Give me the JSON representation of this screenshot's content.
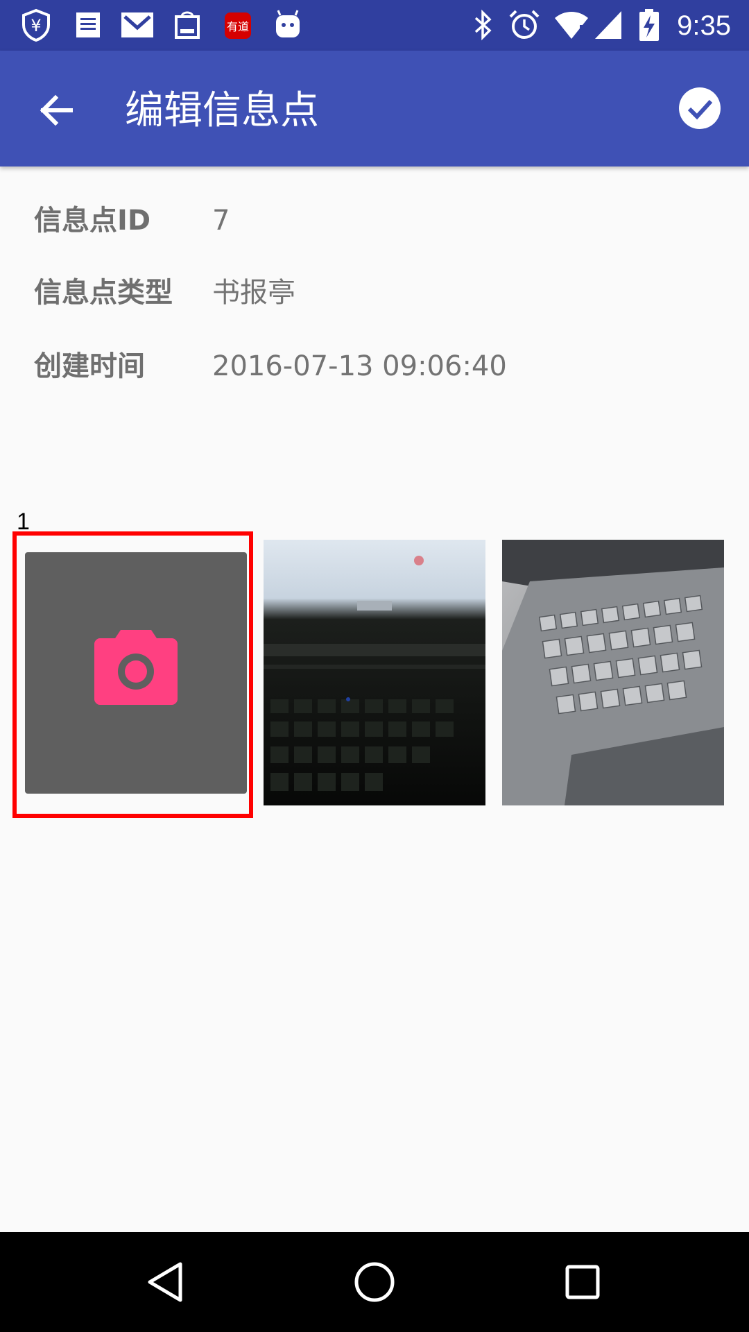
{
  "status_bar": {
    "time": "9:35",
    "left_icons": [
      "shield-yen-icon",
      "news-icon",
      "gmail-icon",
      "shop-bag-icon",
      "youdao-icon",
      "android-icon"
    ],
    "right_icons": [
      "bluetooth-icon",
      "alarm-icon",
      "wifi-icon",
      "signal-icon",
      "battery-charging-icon"
    ],
    "youdao_label": "有道"
  },
  "app_bar": {
    "title": "编辑信息点",
    "back_icon": "arrow-back-icon",
    "confirm_icon": "check-circle-icon",
    "background": "#3f51b5"
  },
  "info": {
    "rows": [
      {
        "label": "信息点ID",
        "value": "7"
      },
      {
        "label": "信息点类型",
        "value": "书报亭"
      },
      {
        "label": "创建时间",
        "value": "2016-07-13 09:06:40"
      }
    ]
  },
  "photos": {
    "counter": "1",
    "add_button_icon": "camera-icon",
    "add_button_color": "#ff4081",
    "highlight_color": "#ff0000"
  },
  "nav_bar": {
    "buttons": [
      "back-triangle-icon",
      "home-circle-icon",
      "recents-square-icon"
    ]
  }
}
